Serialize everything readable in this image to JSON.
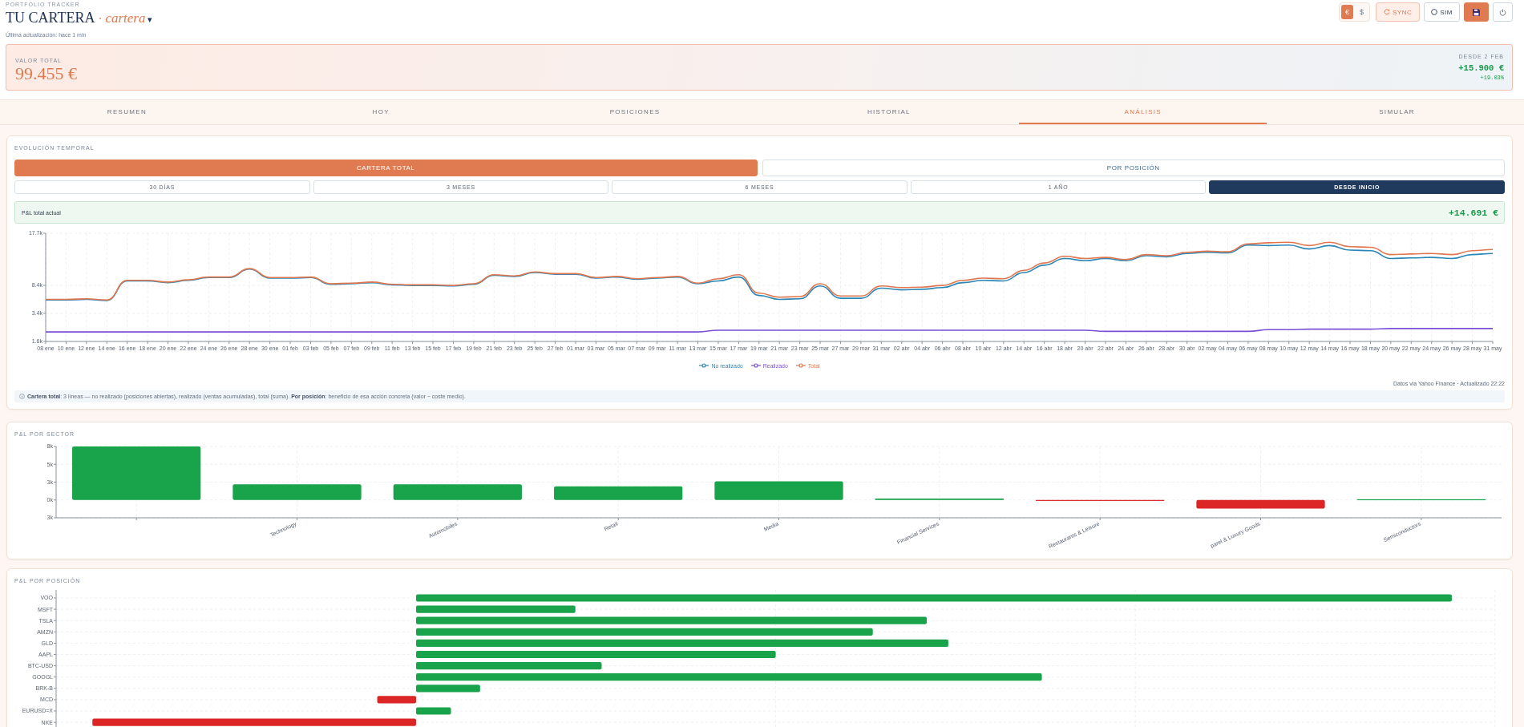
{
  "header": {
    "eyebrow": "PORTFOLIO TRACKER",
    "title": "TU CARTERA",
    "separator": "·",
    "portfolio": "cartera",
    "caret": "▾",
    "updated": "Última actualización: hace 1 min"
  },
  "toolbar": {
    "currencies": [
      {
        "label": "€",
        "selected": true
      },
      {
        "label": "$",
        "selected": false
      }
    ],
    "actions": [
      {
        "kind": "sync",
        "label": "SYNC"
      },
      {
        "kind": "sim",
        "label": "SIM"
      },
      {
        "kind": "save"
      },
      {
        "kind": "power"
      }
    ]
  },
  "summary": {
    "label": "VALOR TOTAL",
    "value": "99.455 €",
    "period": "DESDE 2 FEB",
    "change": "+15.900 €",
    "change_percent": "+19.03%"
  },
  "tabs": [
    {
      "label": "RESUMEN",
      "selected": false
    },
    {
      "label": "HOY",
      "selected": false
    },
    {
      "label": "POSICIONES",
      "selected": false
    },
    {
      "label": "HISTORIAL",
      "selected": false
    },
    {
      "label": "ANÁLISIS",
      "selected": true
    },
    {
      "label": "SIMULAR",
      "selected": false
    }
  ],
  "evolution": {
    "title": "EVOLUCIÓN TEMPORAL",
    "modes": [
      {
        "label": "CARTERA TOTAL",
        "selected": true
      },
      {
        "label": "POR POSICIÓN",
        "selected": false
      }
    ],
    "ranges": [
      {
        "label": "30 DÍAS",
        "selected": false
      },
      {
        "label": "3 MESES",
        "selected": false
      },
      {
        "label": "6 MESES",
        "selected": false
      },
      {
        "label": "1 AÑO",
        "selected": false
      },
      {
        "label": "DESDE INICIO",
        "selected": true
      }
    ],
    "pnl": {
      "label": "P&L total actual",
      "value": "+14.691 €"
    },
    "chart_data": {
      "type": "line",
      "grid": true,
      "categories": [
        "08 ene",
        "10 ene",
        "12 ene",
        "14 ene",
        "16 ene",
        "18 ene",
        "20 ene",
        "22 ene",
        "24 ene",
        "26 ene",
        "28 ene",
        "30 ene",
        "01 feb",
        "03 feb",
        "05 feb",
        "07 feb",
        "09 feb",
        "11 feb",
        "13 feb",
        "15 feb",
        "17 feb",
        "19 feb",
        "21 feb",
        "23 feb",
        "25 feb",
        "27 feb",
        "01 mar",
        "03 mar",
        "05 mar",
        "07 mar",
        "09 mar",
        "11 mar",
        "13 mar",
        "15 mar",
        "17 mar",
        "19 mar",
        "21 mar",
        "23 mar",
        "25 mar",
        "27 mar",
        "29 mar",
        "31 mar",
        "02 abr",
        "04 abr",
        "06 abr",
        "08 abr",
        "10 abr",
        "12 abr",
        "14 abr",
        "16 abr",
        "18 abr",
        "20 abr",
        "22 abr",
        "24 abr",
        "26 abr",
        "28 abr",
        "30 abr",
        "02 may",
        "04 may",
        "06 may",
        "08 may",
        "10 may",
        "12 may",
        "14 may",
        "16 may",
        "18 may",
        "20 may",
        "22 may",
        "24 may",
        "26 may",
        "28 may",
        "31 may"
      ],
      "series": [
        {
          "name": "No realizado",
          "color": "#2b86b5",
          "values": [
            5800,
            5800,
            5900,
            5700,
            9200,
            9200,
            8900,
            9300,
            9800,
            9800,
            11300,
            9700,
            9700,
            9800,
            8600,
            8700,
            8900,
            8500,
            8400,
            8400,
            8300,
            8600,
            10200,
            10000,
            10700,
            10400,
            10400,
            9700,
            9900,
            9500,
            9700,
            9900,
            8700,
            9200,
            9900,
            6600,
            5900,
            6000,
            8300,
            6100,
            6100,
            7900,
            7600,
            7700,
            8000,
            8900,
            9300,
            9200,
            10700,
            12000,
            13200,
            12800,
            13200,
            12800,
            13700,
            13500,
            14100,
            14300,
            14200,
            15600,
            15500,
            15600,
            14900,
            15500,
            14700,
            14600,
            13200,
            13300,
            13400,
            13200,
            13900,
            14100
          ]
        },
        {
          "name": "Realizado",
          "color": "#7b4fd8",
          "values": [
            100,
            100,
            100,
            100,
            100,
            100,
            100,
            100,
            100,
            100,
            100,
            100,
            100,
            100,
            100,
            100,
            100,
            100,
            100,
            100,
            100,
            100,
            100,
            100,
            100,
            100,
            100,
            100,
            100,
            100,
            100,
            100,
            100,
            400,
            400,
            400,
            400,
            400,
            400,
            400,
            400,
            400,
            400,
            400,
            400,
            400,
            400,
            400,
            400,
            400,
            400,
            400,
            200,
            200,
            200,
            200,
            200,
            200,
            200,
            200,
            500,
            500,
            600,
            600,
            600,
            600,
            700,
            700,
            700,
            700,
            700,
            700
          ]
        },
        {
          "name": "Total",
          "color": "#e0774f",
          "values": [
            5900,
            5900,
            6000,
            5800,
            9300,
            9300,
            9000,
            9400,
            9900,
            9900,
            11400,
            9800,
            9800,
            9900,
            8700,
            8800,
            9000,
            8600,
            8500,
            8500,
            8400,
            8700,
            10300,
            10100,
            10800,
            10500,
            10500,
            9800,
            10000,
            9600,
            9800,
            10000,
            8800,
            9600,
            10300,
            7000,
            6300,
            6400,
            8700,
            6500,
            6500,
            8300,
            8000,
            8100,
            8400,
            9300,
            9700,
            9600,
            11100,
            12400,
            13600,
            13200,
            13400,
            13000,
            13900,
            13700,
            14300,
            14500,
            14400,
            15800,
            16000,
            16100,
            15500,
            16100,
            15300,
            15200,
            13900,
            14000,
            14100,
            13900,
            14600,
            14800
          ]
        }
      ],
      "ylim": [
        -1600,
        17700
      ],
      "yticks": [
        {
          "value": -1600,
          "label": "1.6k"
        },
        {
          "value": 3400,
          "label": "3.4k"
        },
        {
          "value": 8400,
          "label": "8.4k"
        },
        {
          "value": 17700,
          "label": "17.7k"
        }
      ]
    },
    "source": "Datos via Yahoo Finance · Actualizado 22:22",
    "note": "**Cartera total**: 3 líneas — no realizado (posiciones abiertas), realizado (ventas acumuladas), total (suma). **Por posición**: beneficio de esa acción concreta (valor − coste medio)."
  },
  "sectors": {
    "title": "P&L POR SECTOR",
    "chart_data": {
      "type": "bar",
      "grid": true,
      "categories": [
        null,
        "Technology",
        "Automobiles",
        "Retail",
        "Media",
        "Financial Services",
        "Restaurants & Leisure",
        "parel & Luxury Goods",
        "Semiconductors"
      ],
      "values": [
        7500,
        2200,
        2200,
        1900,
        2600,
        200,
        -100,
        -1200,
        100
      ],
      "ylim": [
        -2500,
        7500
      ],
      "yticks": [
        {
          "value": -2500,
          "label": "3k"
        },
        {
          "value": 0,
          "label": "0k"
        },
        {
          "value": 2500,
          "label": "3k"
        },
        {
          "value": 5000,
          "label": "5k"
        },
        {
          "value": 7500,
          "label": "8k"
        }
      ]
    }
  },
  "positions": {
    "title": "P&L POR POSICIÓN",
    "rows": [
      {
        "label": "VOO",
        "color": "#19a34a"
      },
      {
        "label": "MSFT",
        "color": "#19a34a"
      },
      {
        "label": "TSLA",
        "color": "#19a34a"
      },
      {
        "label": "AMZN",
        "color": "#19a34a"
      },
      {
        "label": "GLD",
        "color": "#19a34a"
      },
      {
        "label": "AAPL",
        "color": "#19a34a"
      },
      {
        "label": "BTC-USD",
        "color": "#19a34a"
      },
      {
        "label": "GOOGL",
        "color": "#19a34a"
      },
      {
        "label": "BRK-B",
        "color": "#19a34a"
      },
      {
        "label": "MCD",
        "color": "#dc2626"
      },
      {
        "label": "EURUSD=X",
        "color": "#19a34a"
      },
      {
        "label": "NKE",
        "color": "#dc2626"
      }
    ]
  }
}
